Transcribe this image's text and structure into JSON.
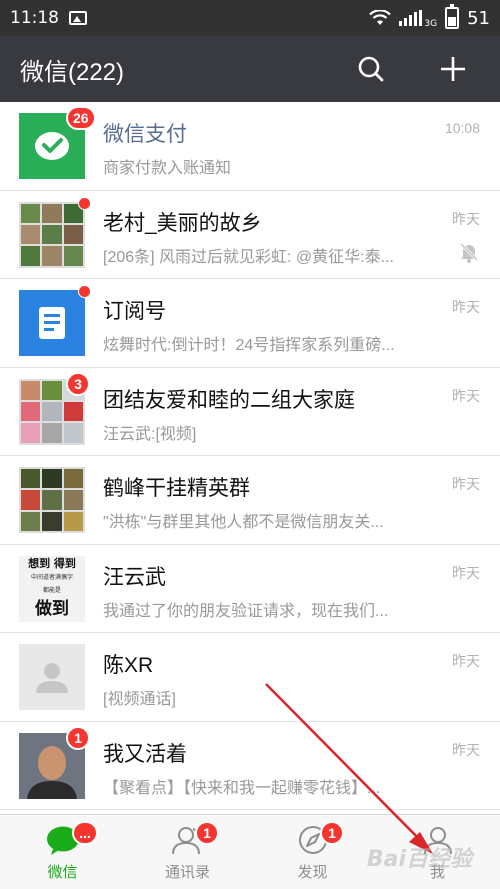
{
  "status_bar": {
    "time": "11:18",
    "network": "3G",
    "battery": "51"
  },
  "header": {
    "title": "微信(222)",
    "icons": [
      "search-icon",
      "plus-icon"
    ]
  },
  "chats": [
    {
      "name": "微信支付",
      "snippet": "商家付款入账通知",
      "time": "10:08",
      "badge": "26",
      "name_link": true
    },
    {
      "name": "老村_美丽的故乡",
      "snippet": "[206条] 风雨过后就见彩虹: @黄征华:泰...",
      "time": "昨天",
      "dot": true,
      "muted": true
    },
    {
      "name": "订阅号",
      "snippet": "炫舞时代:倒计时！24号指挥家系列重磅...",
      "time": "昨天",
      "dot": true
    },
    {
      "name": "团结友爱和睦的二组大家庭",
      "snippet": "汪云武:[视频]",
      "time": "昨天",
      "badge": "3"
    },
    {
      "name": "鹤峰干挂精英群",
      "snippet": "\"洪栋\"与群里其他人都不是微信朋友关...",
      "time": "昨天"
    },
    {
      "name": "汪云武",
      "snippet": "我通过了你的朋友验证请求，现在我们...",
      "time": "昨天",
      "avatar_text": [
        "想到 得到",
        "中间道者满偶字",
        "都能是",
        "做到"
      ]
    },
    {
      "name": "陈XR",
      "snippet": "[视频通话]",
      "time": "昨天"
    },
    {
      "name": "我又活着",
      "snippet": "【聚看点】【快来和我一起赚零花钱】...",
      "time": "昨天",
      "badge": "1"
    }
  ],
  "tabs": [
    {
      "label": "微信",
      "badge": "...",
      "active": true
    },
    {
      "label": "通讯录",
      "badge": "1"
    },
    {
      "label": "发现",
      "badge": "1"
    },
    {
      "label": "我"
    }
  ],
  "colors": {
    "accent": "#1aad19",
    "header_bg": "#393a3f",
    "badge": "#f43530",
    "arrow": "#d9262b"
  },
  "watermark": "Bai百经验"
}
